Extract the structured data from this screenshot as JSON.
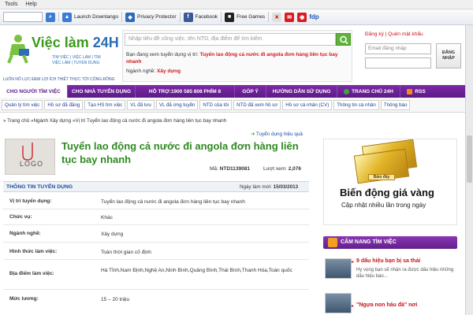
{
  "browser": {
    "menu": [
      "Tools",
      "Help"
    ],
    "toolbar_items": [
      {
        "label": "Launch Downtango",
        "icon": "downtango-icon",
        "color": "#3b7bd4"
      },
      {
        "label": "Privacy Protector",
        "icon": "shield-icon",
        "color": "#2f6ab8"
      },
      {
        "label": "Facebook",
        "icon": "facebook-icon",
        "color": "#3b5998"
      },
      {
        "label": "Free Games",
        "icon": "games-icon",
        "color": "#222222"
      }
    ],
    "toolbar_extra": "fdp"
  },
  "site": {
    "logo_title": "Việc làm",
    "logo_title_num": "24H",
    "logo_sub1": "TÌM VIỆC | VIỆC LÀM | TÌM",
    "logo_sub2": "VIỆC LÀM | TUYỂN DỤNG",
    "slogan": "LUÔN NỖ LỰC ĐEM LỢI ÍCH THIẾT THỰC TỚI CỘNG ĐỒNG",
    "search_placeholder": "Nhập tiêu đề công việc, tên NTD, địa điểm để tìm kiếm",
    "viewing_prefix": "Bạn đang xem tuyển dụng vị trí:",
    "viewing_job": "Tuyển lao động cả nước đi angola đơn hàng liên tục bay nhanh",
    "industry_prefix": "Ngành nghề:",
    "industry": "Xây dựng",
    "login_links": "Đăng ký | Quên mật khẩu",
    "email_placeholder": "Email đăng nhập",
    "login_button": "ĐĂNG NHẬP"
  },
  "nav": {
    "items": [
      {
        "label": "CHO NGƯỜI TÌM VIỆC",
        "active": true
      },
      {
        "label": "CHO NHÀ TUYỂN DỤNG",
        "active": false
      },
      {
        "label": "HỖ TRỢ:1900 585 808 PHÍM 8",
        "active": false
      },
      {
        "label": "GÓP Ý",
        "active": false
      },
      {
        "label": "HƯỚNG DẪN SỬ DỤNG",
        "active": false
      },
      {
        "label": "TRANG CHỦ 24H",
        "active": false
      },
      {
        "label": "RSS",
        "active": false
      }
    ],
    "subitems": [
      "Quản lý tìm việc",
      "Hồ sơ đã đăng",
      "Tạo HS tìm việc",
      "VL đã lưu",
      "VL đã ứng tuyển",
      "NTD của tôi",
      "NTD đã xem hồ sơ",
      "Hồ sơ cá nhân (CV)",
      "Thông tin cá nhân",
      "Thông báo"
    ]
  },
  "breadcrumb": "» Trang chủ »Ngành Xây dựng »Vị trí Tuyển lao động cả nước đi angola đơn hàng liên tục bay nhanh",
  "effective_label": "Tuyển dụng hiệu quả",
  "job": {
    "logo_text": "LOGO",
    "title": "Tuyển lao động cả nước đi angola đơn hàng liên tục bay nhanh",
    "code_label": "Mã:",
    "code": "NTD1139081",
    "views_label": "Lượt xem:",
    "views": "2,076"
  },
  "info": {
    "heading": "THÔNG TIN TUYỂN DỤNG",
    "date_label": "Ngày làm mới:",
    "date": "15/03/2013",
    "rows": [
      {
        "key": "Vị trí tuyển dụng:",
        "value": "Tuyển lao động cả nước đi angola đơn hàng liên tục bay nhanh"
      },
      {
        "key": "Chức vụ:",
        "value": "Khác"
      },
      {
        "key": "Ngành nghề:",
        "value": "Xây dựng"
      },
      {
        "key": "Hình thức làm việc:",
        "value": "Toàn thời gian cố định"
      },
      {
        "key": "Địa điểm làm việc:",
        "value": "Hà Tĩnh,Nam Định,Nghệ An,Ninh Bình,Quảng Bình,Thái Bình,Thanh Hóa,Toàn quốc"
      },
      {
        "key": "Mức lương:",
        "value": "15 – 20 triệu"
      }
    ]
  },
  "ad": {
    "bar_label": "Bấm đây",
    "title": "Biến động giá vàng",
    "subtitle": "Cập nhật nhiều lần trong ngày"
  },
  "cam_nang": {
    "heading": "CẨM NANG TÌM VIỆC",
    "items": [
      {
        "title": "9 dấu hiệu bạn bị sa thải",
        "desc": "Hy vọng bạn sẽ nhận ra được dấu hiệu những dấu hiệu báo..."
      },
      {
        "title": "\"Ngựa non háu đá\" nơi",
        "desc": ""
      }
    ]
  }
}
